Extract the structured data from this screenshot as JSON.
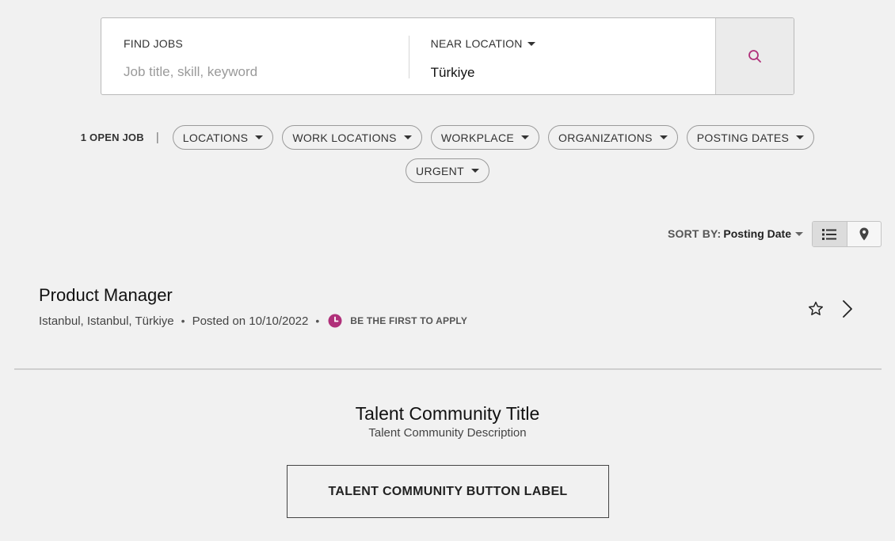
{
  "search": {
    "find_label": "FIND JOBS",
    "find_placeholder": "Job title, skill, keyword",
    "location_label": "NEAR LOCATION",
    "location_value": "Türkiye"
  },
  "filters": {
    "count": "1 OPEN JOB",
    "separator": "|",
    "chips": [
      "LOCATIONS",
      "WORK LOCATIONS",
      "WORKPLACE",
      "ORGANIZATIONS",
      "POSTING DATES",
      "URGENT"
    ]
  },
  "sort": {
    "label": "SORT BY:",
    "value": "Posting Date"
  },
  "jobs": [
    {
      "title": "Product Manager",
      "location": "Istanbul, Istanbul, Türkiye",
      "posted": "Posted on 10/10/2022",
      "badge": "BE THE FIRST TO APPLY"
    }
  ],
  "talent": {
    "title": "Talent Community Title",
    "description": "Talent Community Description",
    "button_label": "TALENT COMMUNITY BUTTON LABEL"
  },
  "colors": {
    "accent": "#b0307a",
    "background": "#f1f1f1"
  }
}
